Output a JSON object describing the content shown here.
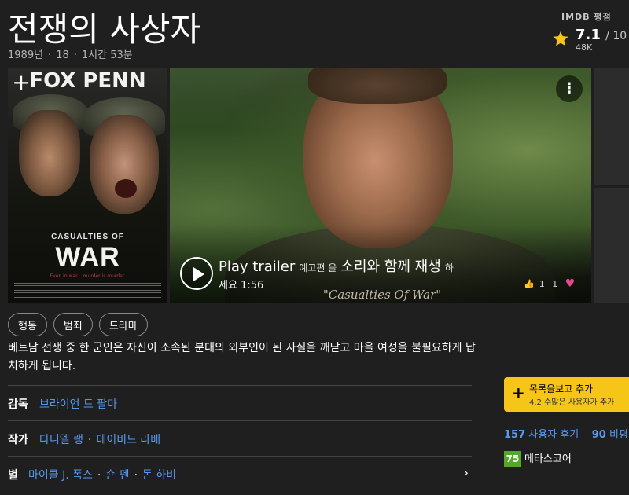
{
  "title": "전쟁의 사상자",
  "meta": {
    "year": "1989년",
    "rating": "18",
    "duration": "1시간 53분"
  },
  "imdb": {
    "label": "IMDB 평점",
    "score": "7.1",
    "max": "/ 10",
    "count": "48K"
  },
  "poster": {
    "actors_text": "FOX PENN",
    "casualties_text": "CASUALTIES OF",
    "war_text": "WAR",
    "tagline": "Even in war... murder is murder."
  },
  "video": {
    "subtitle": "\"Casualties Of War\"",
    "trailer_big": "Play trailer",
    "trailer_small": "예고편 을",
    "trailer_big2": "소리와 함께 재생",
    "trailer_small2": "하",
    "trailer_line2": "세요 1:56",
    "likes": "1",
    "dislikes": "1"
  },
  "genres": [
    "행동",
    "범죄",
    "드라마"
  ],
  "plot": "베트남 전쟁 중 한 군인은 자신이 소속된 분대의 외부인이 된 사실을 깨닫고 마을 여성을 불필요하게 납치하게 됩니다.",
  "credits": {
    "director_label": "감독",
    "director": "브라이언 드 팔마",
    "writer_label": "작가",
    "writers": [
      "다니엘 랭",
      "데이비드 라베"
    ],
    "stars_label": "별",
    "stars": [
      "마이클 J. 폭스",
      "숀 펜",
      "돈 하비"
    ]
  },
  "watchlist": {
    "label": "목록을보고 추가",
    "sub": "4.2 수많은 사용자가 추가"
  },
  "reviews": {
    "user_count": "157",
    "user_label": "사용자 후기",
    "critic_count": "90",
    "critic_label": "비평"
  },
  "metascore": {
    "value": "75",
    "label": "메타스코어"
  },
  "colors": {
    "accent": "#f5c518",
    "link": "#5799ef",
    "metascore": "#54a72a",
    "heart": "#e24b8f"
  }
}
